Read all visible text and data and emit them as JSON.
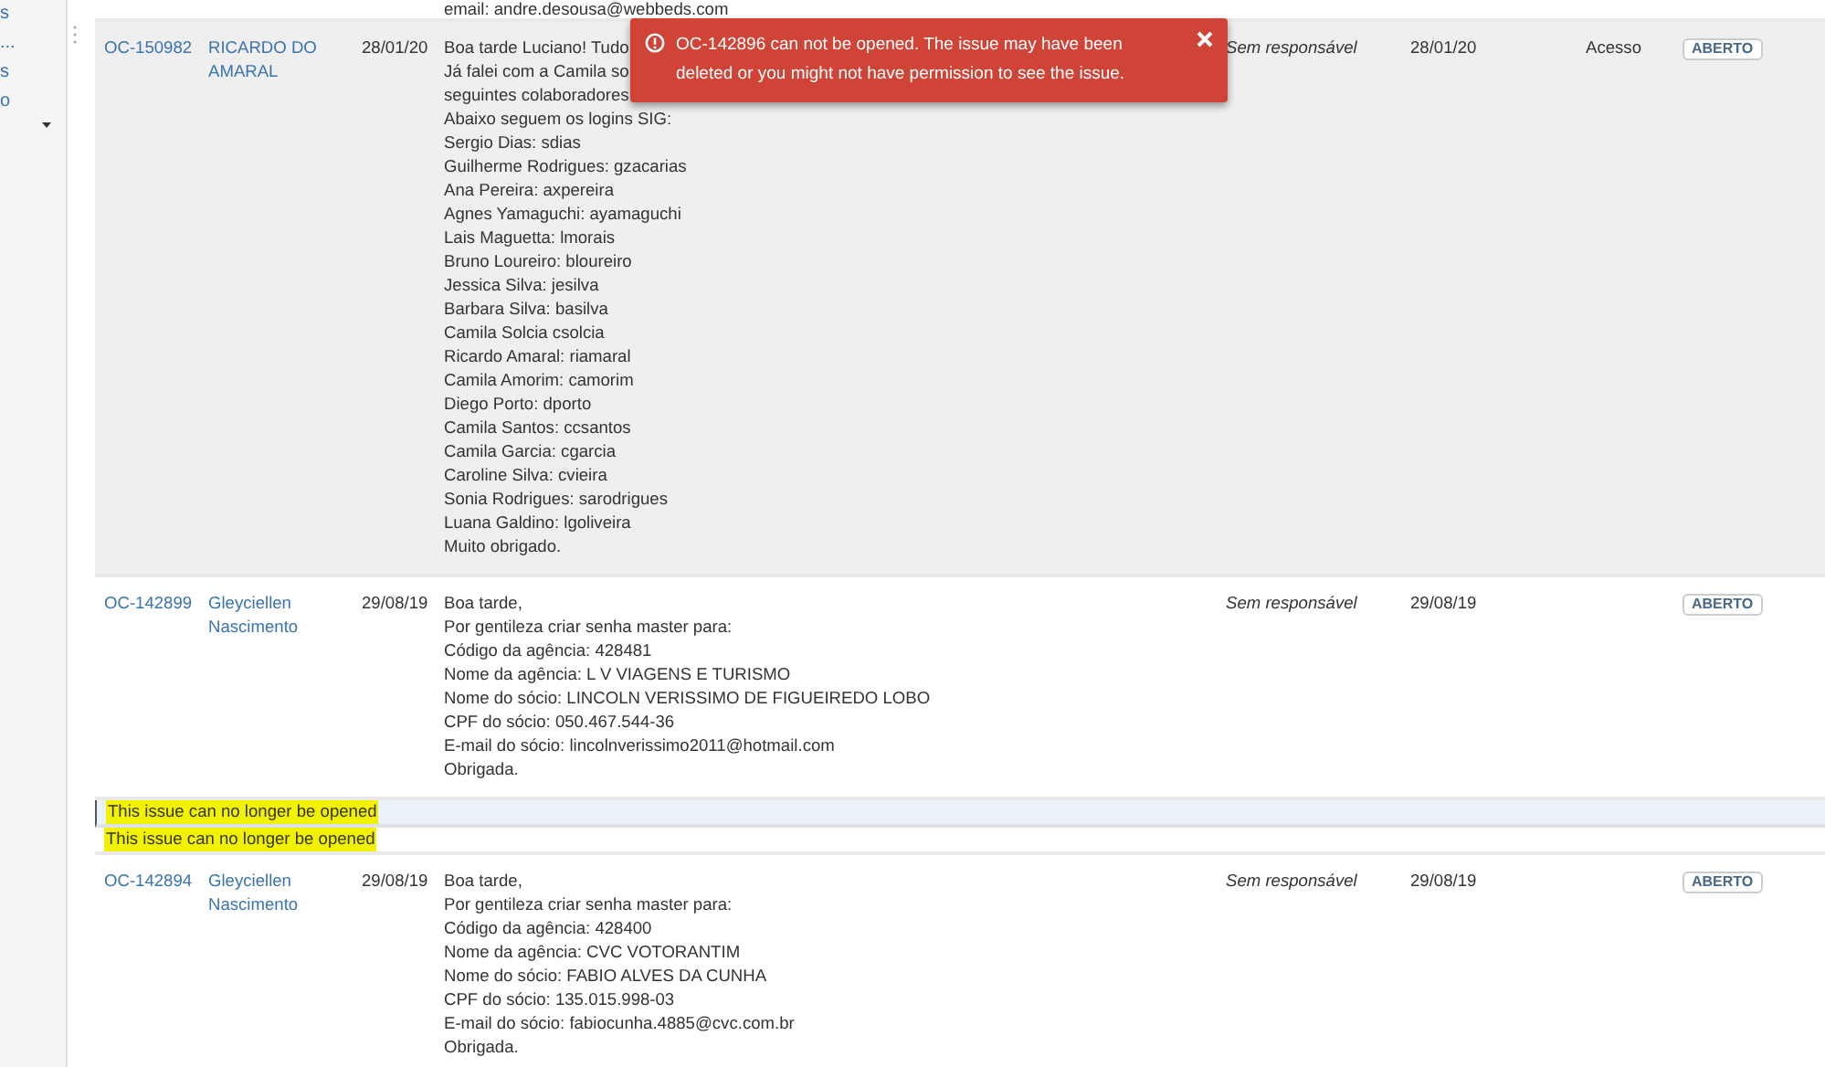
{
  "sidebar": {
    "items": [
      {
        "label": "s"
      },
      {
        "label": "..."
      },
      {
        "label": "s"
      },
      {
        "label": "o"
      }
    ]
  },
  "top_row_fragment": "email: andre.desousa@webbeds.com",
  "toast": {
    "message": "OC-142896 can not be opened. The issue may have been deleted or you might not have permission to see the issue."
  },
  "rows": [
    {
      "kind": "issue",
      "selected": true,
      "key": "OC-150982",
      "reporter": "RICARDO DO AMARAL",
      "created": "28/01/20",
      "description": [
        "Boa tarde Luciano! Tudo",
        "Já falei com a Camila so",
        "seguintes colaboradores",
        "Abaixo seguem os logins SIG:",
        "Sergio Dias: sdias",
        "Guilherme Rodrigues: gzacarias",
        "Ana Pereira: axpereira",
        "Agnes Yamaguchi: ayamaguchi",
        "Lais Maguetta: lmorais",
        "Bruno Loureiro: bloureiro",
        "Jessica Silva: jesilva",
        "Barbara Silva: basilva",
        "Camila Solcia csolcia",
        "Ricardo Amaral: riamaral",
        "Camila Amorim: camorim",
        "Diego Porto: dporto",
        "Camila Santos: ccsantos",
        "Camila Garcia: cgarcia",
        "Caroline Silva: cvieira",
        "Sonia Rodrigues: sarodrigues",
        "Luana Galdino: lgoliveira",
        "Muito obrigado."
      ],
      "assignee": "Sem responsável",
      "updated": "28/01/20",
      "category": "Acesso",
      "status": "ABERTO"
    },
    {
      "kind": "issue",
      "selected": false,
      "key": "OC-142899",
      "reporter": "Gleyciellen Nascimento",
      "created": "29/08/19",
      "description": [
        "Boa tarde,",
        "Por gentileza criar senha master para:",
        "Código da agência: 428481",
        "Nome da agência: L V VIAGENS E TURISMO",
        "Nome do sócio: LINCOLN VERISSIMO DE FIGUEIREDO LOBO",
        "CPF do sócio: 050.467.544-36",
        "E-mail do sócio: lincolnverissimo2011@hotmail.com",
        "Obrigada."
      ],
      "assignee": "Sem responsável",
      "updated": "29/08/19",
      "status": "ABERTO"
    },
    {
      "kind": "notice",
      "selected": true,
      "message": "This issue can no longer be opened"
    },
    {
      "kind": "notice",
      "selected": false,
      "message": "This issue can no longer be opened"
    },
    {
      "kind": "issue",
      "selected": false,
      "key": "OC-142894",
      "reporter": "Gleyciellen Nascimento",
      "created": "29/08/19",
      "description": [
        "Boa tarde,",
        "Por gentileza criar senha master para:",
        "Código da agência: 428400",
        "Nome da agência: CVC VOTORANTIM",
        "Nome do sócio: FABIO ALVES DA CUNHA",
        "CPF do sócio: 135.015.998-03",
        "E-mail do sócio: fabiocunha.4885@cvc.com.br",
        "Obrigada."
      ],
      "assignee": "Sem responsável",
      "updated": "29/08/19",
      "status": "ABERTO"
    }
  ]
}
